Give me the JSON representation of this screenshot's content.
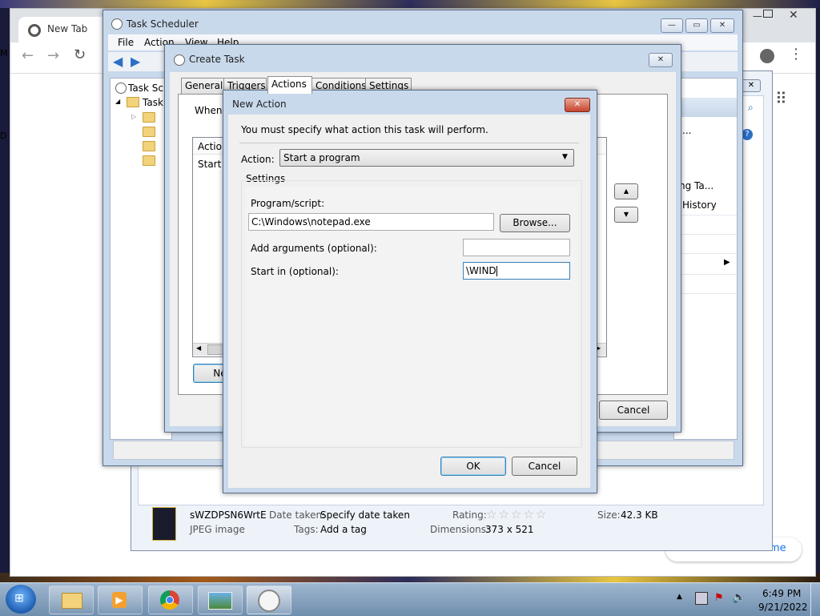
{
  "chrome": {
    "tab_title": "New Tab",
    "apps_icon": "apps-grid-icon",
    "desktop_edge_letters": [
      "M",
      "D"
    ],
    "behind_text_fragment": "me"
  },
  "task_scheduler": {
    "title": "Task Scheduler",
    "menu": [
      "File",
      "Action",
      "View",
      "Help"
    ],
    "tree_items": [
      "Task Sc",
      "Task"
    ],
    "right_pane": {
      "ellipsis": "...",
      "items": [
        "ng Ta...",
        "History"
      ]
    }
  },
  "create_task": {
    "title": "Create Task",
    "tabs": [
      "General",
      "Triggers",
      "Actions",
      "Conditions",
      "Settings"
    ],
    "active_tab": "Actions",
    "when_text": "When y",
    "list_header": "Action",
    "list_row": "Start a",
    "new_button": "Nev",
    "cancel_button": "Cancel"
  },
  "new_action": {
    "title": "New Action",
    "instruction": "You must specify what action this task will perform.",
    "action_label": "Action:",
    "action_value": "Start a program",
    "settings_group": "Settings",
    "program_label": "Program/script:",
    "program_value": "C:\\Windows\\notepad.exe",
    "browse_button": "Browse...",
    "args_label": "Add arguments (optional):",
    "args_value": "",
    "start_in_label": "Start in (optional):",
    "start_in_value": "\\WIND",
    "ok_button": "OK",
    "cancel_button": "Cancel"
  },
  "photo_viewer": {
    "filename": "sWZDPSN6WrtE",
    "filetype": "JPEG image",
    "date_taken_label": "Date taken:",
    "date_taken_value": "Specify date taken",
    "tags_label": "Tags:",
    "tags_value": "Add a tag",
    "rating_label": "Rating:",
    "rating_stars": 0,
    "dimensions_label": "Dimensions:",
    "dimensions_value": "373 x 521",
    "size_label": "Size:",
    "size_value": "42.3 KB"
  },
  "taskbar": {
    "time": "6:49 PM",
    "date": "9/21/2022"
  }
}
